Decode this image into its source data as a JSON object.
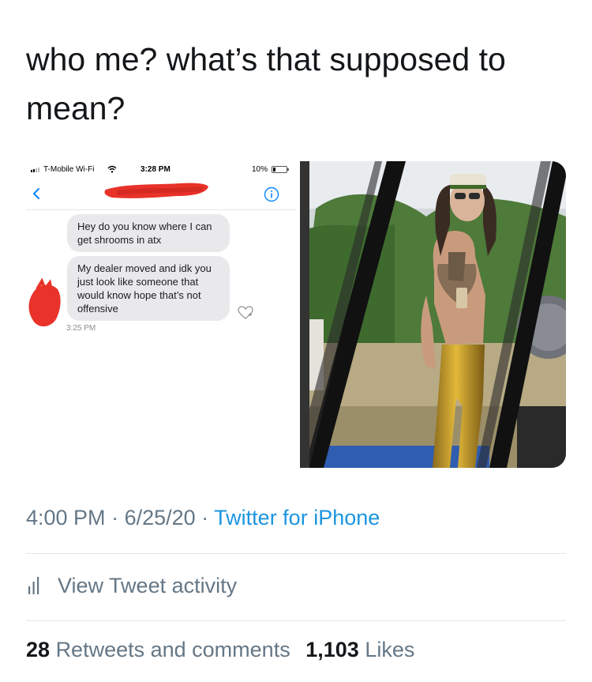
{
  "tweet": {
    "text": "who me? what’s that supposed to mean?"
  },
  "screenshot": {
    "status_bar": {
      "carrier": "T-Mobile Wi-Fi",
      "time": "3:28 PM",
      "battery": "10%"
    },
    "messages": [
      {
        "text": "Hey do you know where I can get shrooms in atx"
      },
      {
        "text": "My dealer moved and idk you just look like someone that would know hope that’s not offensive"
      }
    ],
    "message_time": "3:25 PM",
    "redaction_color": "#e8322a"
  },
  "meta": {
    "time": "4:00 PM",
    "separator": " · ",
    "date": "6/25/20",
    "source": "Twitter for iPhone"
  },
  "activity": {
    "label": "View Tweet activity"
  },
  "stats": {
    "retweets_count": "28",
    "retweets_label": "Retweets and comments",
    "likes_count": "1,103",
    "likes_label": "Likes"
  },
  "colors": {
    "link": "#1b95e0",
    "muted": "#657786",
    "text": "#14171a"
  }
}
